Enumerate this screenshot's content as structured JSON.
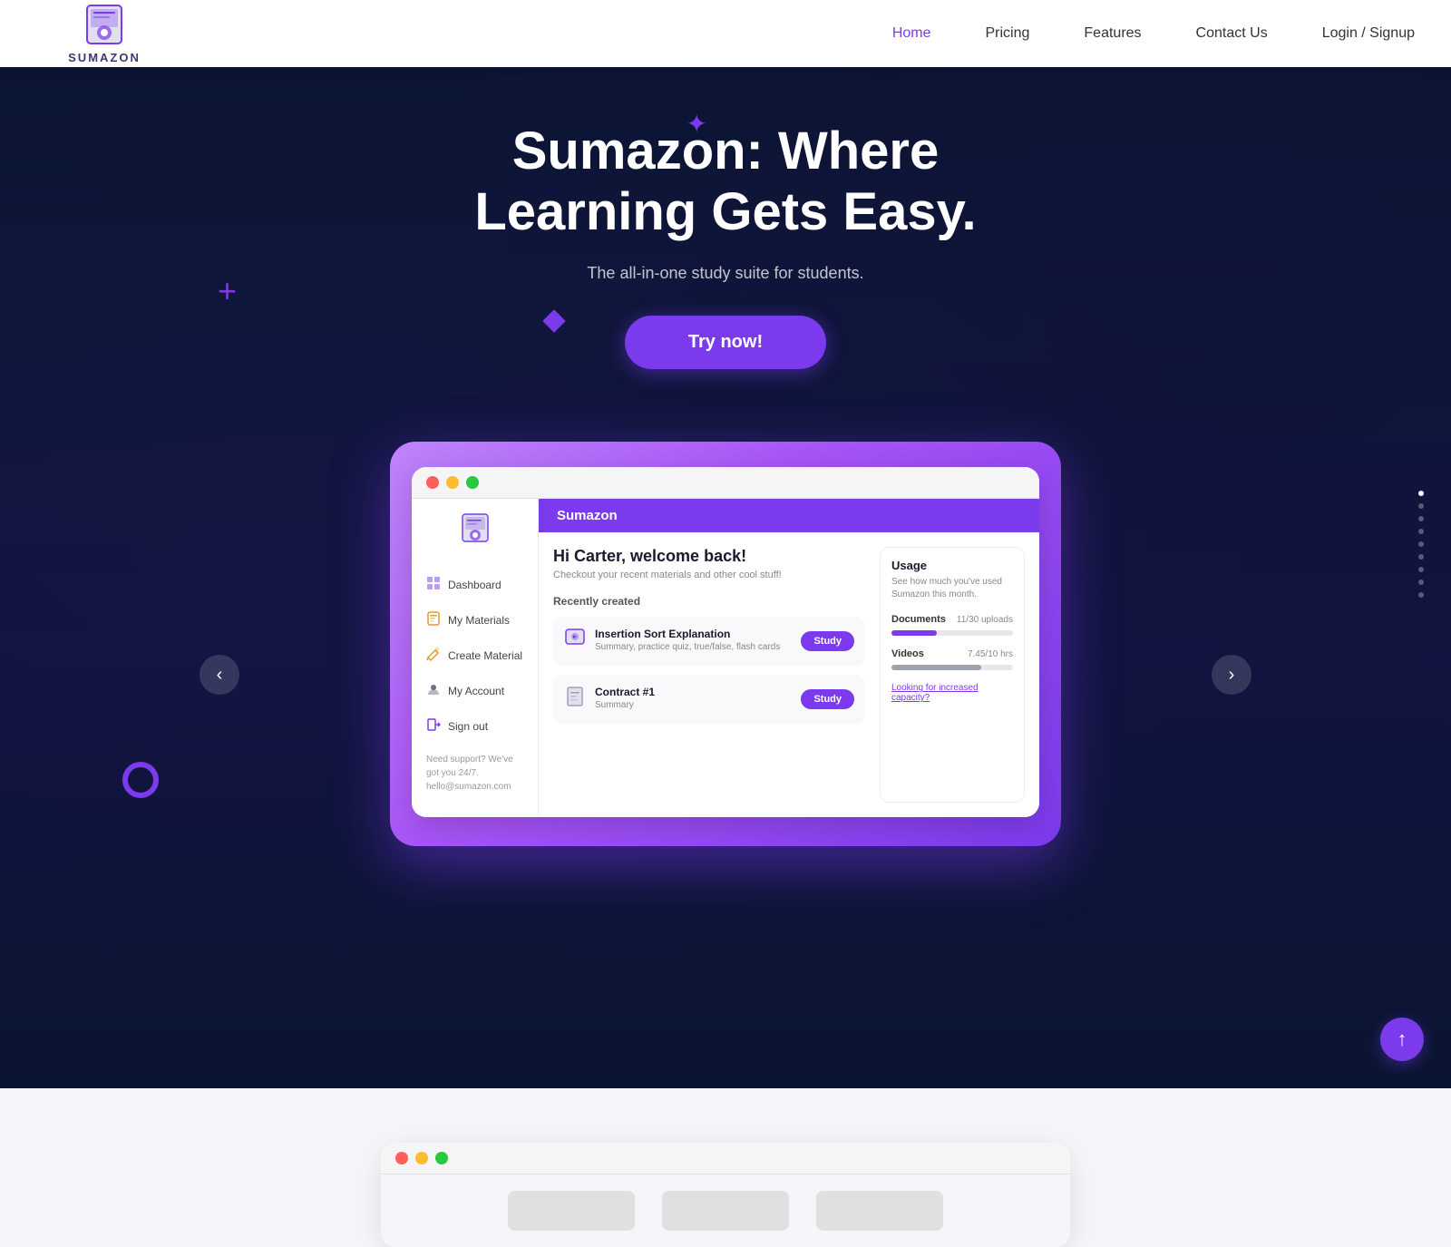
{
  "navbar": {
    "logo_text": "SUMAZON",
    "links": [
      {
        "label": "Home",
        "active": true,
        "id": "home"
      },
      {
        "label": "Pricing",
        "active": false,
        "id": "pricing"
      },
      {
        "label": "Features",
        "active": false,
        "id": "features"
      },
      {
        "label": "Contact Us",
        "active": false,
        "id": "contact"
      },
      {
        "label": "Login / Signup",
        "active": false,
        "id": "login"
      }
    ]
  },
  "hero": {
    "title": "Sumazon: Where Learning Gets Easy.",
    "subtitle": "The all-in-one study suite for students.",
    "cta_label": "Try now!"
  },
  "app_window": {
    "header_title": "Sumazon",
    "greeting": "Hi Carter, welcome back!",
    "greeting_sub": "Checkout your recent materials and other cool stuff!",
    "recently_created_label": "Recently created",
    "sidebar_items": [
      {
        "label": "Dashboard",
        "icon": "🖥"
      },
      {
        "label": "My Materials",
        "icon": "📄"
      },
      {
        "label": "Create Material",
        "icon": "✨"
      }
    ],
    "sidebar_bottom": {
      "support_text": "Need support? We've got you 24/7.",
      "email": "hello@sumazon.com"
    },
    "sidebar_account_items": [
      {
        "label": "My Account",
        "icon": "👤"
      },
      {
        "label": "Sign out",
        "icon": "🚪"
      }
    ],
    "materials": [
      {
        "title": "Insertion Sort Explanation",
        "desc": "Summary, practice quiz, true/false, flash cards",
        "icon": "🎬",
        "btn_label": "Study"
      },
      {
        "title": "Contract #1",
        "desc": "Summary",
        "icon": "📝",
        "btn_label": "Study"
      }
    ],
    "usage": {
      "title": "Usage",
      "desc": "See how much you've used Sumazon this month.",
      "items": [
        {
          "label": "Documents",
          "count": "11/30 uploads",
          "fill_pct": 37,
          "bar_color": "purple"
        },
        {
          "label": "Videos",
          "count": "7.45/10 hrs",
          "fill_pct": 74,
          "bar_color": "gray"
        }
      ],
      "upgrade_link": "Looking for increased capacity?"
    }
  },
  "scroll_dots": {
    "count": 9,
    "active_index": 0
  },
  "scroll_up_btn_label": "↑",
  "decorations": {
    "plus": "+",
    "asterisk": "✦",
    "circle": "",
    "diamond": ""
  }
}
